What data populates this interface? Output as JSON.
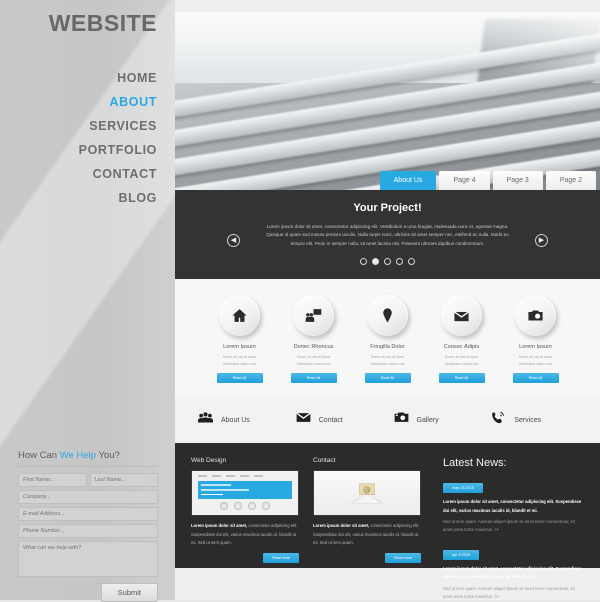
{
  "sidebar": {
    "site_title": "WEBSITE",
    "nav": [
      {
        "label": "HOME",
        "active": false
      },
      {
        "label": "ABOUT",
        "active": true
      },
      {
        "label": "SERVICES",
        "active": false
      },
      {
        "label": "PORTFOLIO",
        "active": false
      },
      {
        "label": "CONTACT",
        "active": false
      },
      {
        "label": "BLOG",
        "active": false
      }
    ],
    "help_form": {
      "title_pre": "How Can ",
      "title_highlight": "We Help",
      "title_post": " You?",
      "first_name_placeholder": "First Name...",
      "last_name_placeholder": "Last Name...",
      "company_placeholder": "Company...",
      "email_placeholder": "E-mail Address...",
      "phone_placeholder": "Phone Number...",
      "message_placeholder": "What can we help with?",
      "submit_label": "Submit"
    }
  },
  "hero": {
    "image_name": "laptop-keyboard-photo",
    "tabs": [
      {
        "label": "About Us",
        "active": true
      },
      {
        "label": "Page 4",
        "active": false
      },
      {
        "label": "Page 3",
        "active": false
      },
      {
        "label": "Page 2",
        "active": false
      }
    ]
  },
  "slider": {
    "title": "Your Project!",
    "text": "Lorem ipsum dolor sit amet, consectetur adipiscing elit. Vestibulum a urna feugiat, malesuada nunc et, egestas magna. Quisque id quam sed massa pretium iaculis. Nulla turpis nunc, ultricies sit amet semper nec, eleifend ac nulla. Morbi eu tempor elit. Proin in semper nulla, sit amet lacinia nisi. Praesent ultricies dapibus condimentum.",
    "prev_label": "◀",
    "next_label": "▶",
    "dots": [
      {
        "active": false
      },
      {
        "active": true
      },
      {
        "active": false
      },
      {
        "active": false
      },
      {
        "active": false
      }
    ]
  },
  "cards": [
    {
      "icon": "home-icon",
      "title": "Lorem Ipsum",
      "sub_line1": "Donec sit nec at lacus",
      "sub_line2": "Vestibulum viverra nisi",
      "button_label": "Read All"
    },
    {
      "icon": "presentation-icon",
      "title": "Donec Rhoncus",
      "sub_line1": "Donec sit nec at lacus",
      "sub_line2": "Vestibulum viverra nisi",
      "button_label": "Read All"
    },
    {
      "icon": "pin-icon",
      "title": "Fringilla Dolor",
      "sub_line1": "Donec sit nec at lacus",
      "sub_line2": "Vestibulum viverra nisi",
      "button_label": "Read All"
    },
    {
      "icon": "envelope-icon",
      "title": "Consec Adipis",
      "sub_line1": "Donec sit nec at lacus",
      "sub_line2": "Vestibulum viverra nisi",
      "button_label": "Read All"
    },
    {
      "icon": "camera-icon",
      "title": "Lorem Ipsum",
      "sub_line1": "Donec sit nec at lacus",
      "sub_line2": "Vestibulum viverra nisi",
      "button_label": "Read All"
    }
  ],
  "strip": [
    {
      "icon": "people-icon",
      "label": "About Us"
    },
    {
      "icon": "envelope-icon",
      "label": "Contact"
    },
    {
      "icon": "camera-icon",
      "label": "Gallery"
    },
    {
      "icon": "phone-icon",
      "label": "Services"
    }
  ],
  "footer": {
    "columns": [
      {
        "title": "Web Design",
        "thumb": "website-mockup-thumb",
        "lead": "Lorem ipsum dolor sit amet,",
        "body": " consectetur adipiscing elit. Suspendisse dui elit, varius maximus iaculis id, blandit ut mi. Sed ut sem quam.",
        "button_label": "Read more"
      },
      {
        "title": "Contact",
        "thumb": "envelope-illustration-thumb",
        "lead": "Lorem ipsum dolor sit amet,",
        "body": " consectetur adipiscing elit. Suspendisse dui elit, varius maximus iaculis id, blandit ut mi. Sed ut sem quam.",
        "button_label": "Read more"
      }
    ],
    "news": {
      "title": "Latest News:",
      "items": [
        {
          "date": "may 23 2015",
          "lead": "Lorem ipsum dolor sit amet, consectetur adipiscing elit. Suspendisse dui elit, varius maximus iaculis id, blandit et mi.",
          "body": "Sed ut sem quam. Aenean aliquet ipsum sit amet lorem consectetur, sit amet porta tortor maximus. >>"
        },
        {
          "date": "apr 9 2015",
          "lead": "Lorem ipsum dolor sit amet, consectetur adipiscing elit. Suspendisse dui elit, varius maximus iaculis id, blandit et mi.",
          "body": "Sed ut sem quam. Aenean aliquet ipsum sit amet lorem consectetur, sit amet porta tortor maximus. >>"
        }
      ]
    }
  },
  "colors": {
    "accent": "#29a9e1",
    "sidebar_bg": "#c8c8c8",
    "dark_band": "#333333",
    "footer_bg": "#2b2b2b",
    "page_bg": "#efefef"
  }
}
